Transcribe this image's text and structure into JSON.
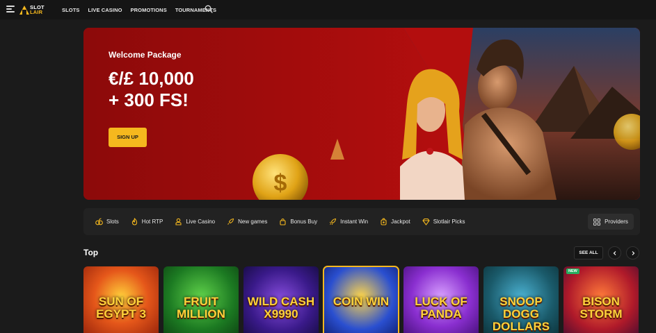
{
  "brand": {
    "name_line1": "SLOT",
    "name_line2": "LAIR",
    "accent": "#f5b81e"
  },
  "nav": {
    "items": [
      "SLOTS",
      "LIVE CASINO",
      "PROMOTIONS",
      "TOURNAMENTS"
    ]
  },
  "hero": {
    "eyebrow": "Welcome Package",
    "title_line1": "€/£ 10,000",
    "title_line2": "+ 300 FS!",
    "cta": "SIGN UP"
  },
  "categories": [
    {
      "label": "Slots",
      "icon": "slots-icon"
    },
    {
      "label": "Hot RTP",
      "icon": "fire-icon"
    },
    {
      "label": "Live Casino",
      "icon": "dealer-icon"
    },
    {
      "label": "New games",
      "icon": "rocket-icon"
    },
    {
      "label": "Bonus Buy",
      "icon": "bag-icon"
    },
    {
      "label": "Instant Win",
      "icon": "rocket-icon"
    },
    {
      "label": "Jackpot",
      "icon": "jackpot-icon"
    },
    {
      "label": "Slotlair Picks",
      "icon": "diamond-icon"
    }
  ],
  "providers_label": "Providers",
  "top_section": {
    "title": "Top",
    "see_all": "SEE ALL"
  },
  "games": [
    {
      "name": "SUN OF EGYPT 3",
      "badge": ""
    },
    {
      "name": "FRUIT MILLION",
      "badge": ""
    },
    {
      "name": "WILD CASH X9990",
      "badge": ""
    },
    {
      "name": "COIN WIN",
      "badge": ""
    },
    {
      "name": "LUCK OF PANDA",
      "badge": ""
    },
    {
      "name": "SNOOP DOGG DOLLARS",
      "badge": ""
    },
    {
      "name": "BISON STORM",
      "badge": "NEW"
    }
  ]
}
